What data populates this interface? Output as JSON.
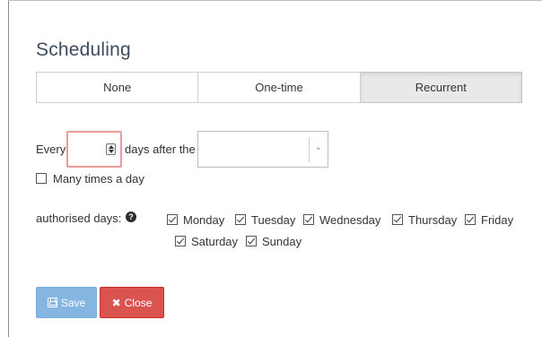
{
  "dialog": {
    "title": "Scheduling"
  },
  "tabs": [
    {
      "label": "None",
      "active": false
    },
    {
      "label": "One-time",
      "active": false
    },
    {
      "label": "Recurrent",
      "active": true
    }
  ],
  "recurrence": {
    "prefix": "Every",
    "interval_value": "",
    "suffix": "days after the",
    "anchor_value": ""
  },
  "many_times": {
    "label": "Many times a day",
    "checked": false
  },
  "authorised_days": {
    "label": "authorised days:",
    "help_icon": "question-circle-icon",
    "days": [
      {
        "label": "Monday",
        "checked": true
      },
      {
        "label": "Tuesday",
        "checked": true
      },
      {
        "label": "Wednesday",
        "checked": true
      },
      {
        "label": "Thursday",
        "checked": true
      },
      {
        "label": "Friday",
        "checked": true
      },
      {
        "label": "Saturday",
        "checked": true
      },
      {
        "label": "Sunday",
        "checked": true
      }
    ]
  },
  "buttons": {
    "save_label": "Save",
    "save_icon": "floppy-disk-icon",
    "close_label": "Close",
    "close_icon": "x-icon"
  },
  "colors": {
    "title": "#3d4b5c",
    "save": "#85b6e1",
    "close": "#d9534f",
    "invalid_border": "#ef9a9a",
    "active_tab": "#e9e9e9"
  }
}
